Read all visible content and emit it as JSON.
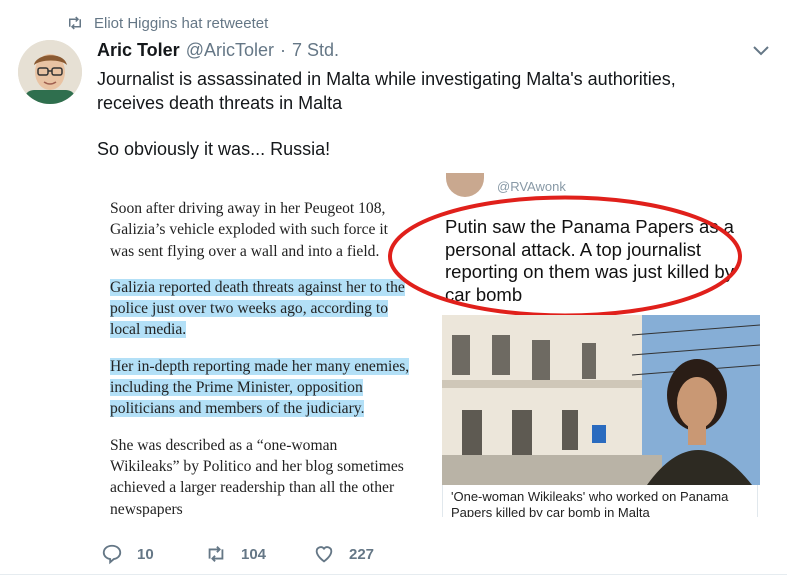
{
  "retweet_line": {
    "icon": "retweet-icon",
    "text": "Eliot Higgins hat retweetet"
  },
  "tweet": {
    "name": "Aric Toler",
    "handle": "@AricToler",
    "separator": "·",
    "time": "7 Std.",
    "text_lines": [
      "Journalist is assassinated in Malta while investigating Malta's authorities,",
      "receives death threats in Malta"
    ],
    "text_2": "So obviously it was... Russia!"
  },
  "media": {
    "article_paragraphs": [
      "Soon after driving away in her Peugeot 108, Galizia’s vehicle exploded with such force it was sent flying over a wall and into a field.",
      "Galizia reported death threats against her to the police just over two weeks ago, according to local media.",
      "Her in-depth reporting made her many enemies, including the Prime Minister, opposition politicians and members of the judiciary.",
      "She was described as a “one-woman Wikileaks” by Politico and her blog sometimes achieved a larger readership than all the other newspapers"
    ],
    "quoted_handle": "@RVAwonk",
    "quote_text": "Putin saw the Panama Papers as a personal attack. A top journalist reporting on them was just killed by car bomb",
    "caption": "'One-woman Wikileaks' who worked on Panama Papers killed by car bomb in Malta",
    "highlight_color": "#b3e0f7",
    "ellipse_color": "#e0201b"
  },
  "actions": {
    "replies": "10",
    "retweets": "104",
    "likes": "227"
  }
}
